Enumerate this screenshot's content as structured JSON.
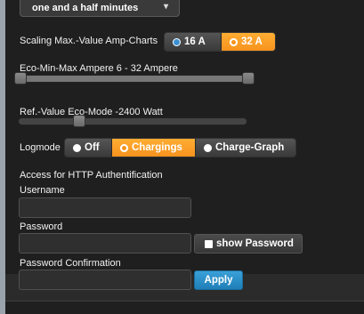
{
  "top_select": {
    "value": "one and a half minutes",
    "caret": "▾"
  },
  "scaling": {
    "label": "Scaling Max.-Value Amp-Charts",
    "options": [
      {
        "label": "16 A",
        "selected": false
      },
      {
        "label": "32 A",
        "selected": true
      }
    ]
  },
  "eco_range": {
    "label": "Eco-Min-Max Ampere 6 - 32 Ampere",
    "min_fraction": 0.0,
    "max_fraction": 1.0
  },
  "ref_value": {
    "label": "Ref.-Value Eco-Mode -2400 Watt",
    "fraction": 0.27
  },
  "logmode": {
    "label": "Logmode",
    "options": [
      {
        "label": "Off",
        "selected": false
      },
      {
        "label": "Chargings",
        "selected": true
      },
      {
        "label": "Charge-Graph",
        "selected": false
      }
    ]
  },
  "auth": {
    "section_label": "Access for HTTP Authentification",
    "username_label": "Username",
    "username_value": "",
    "password_label": "Password",
    "password_value": "",
    "show_password_label": "show Password",
    "confirm_label": "Password Confirmation",
    "confirm_value": "",
    "apply_label": "Apply"
  },
  "colors": {
    "accent": "#f7931e",
    "apply": "#2a8cc8",
    "background": "#1f1f1f"
  }
}
